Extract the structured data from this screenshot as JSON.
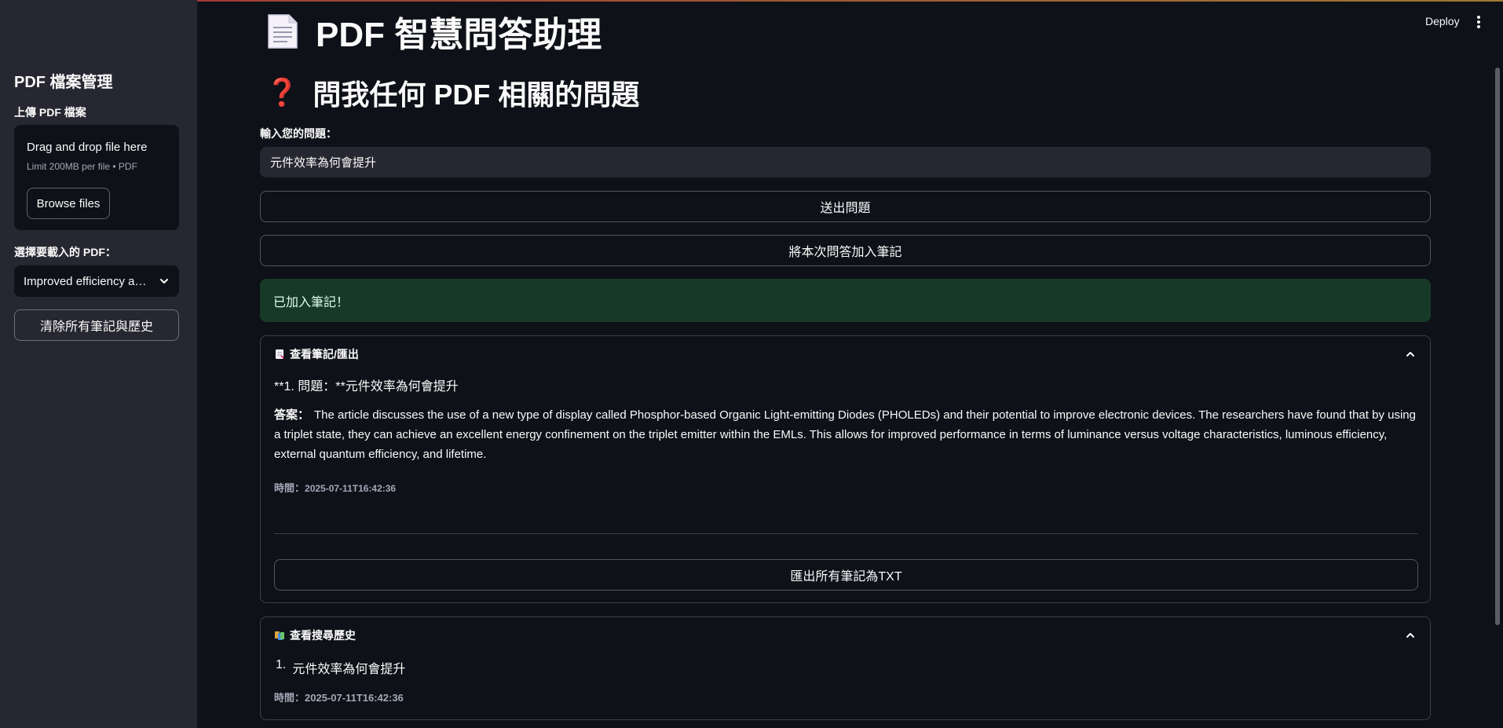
{
  "sidebar": {
    "title": "PDF 檔案管理",
    "upload_label": "上傳 PDF 檔案",
    "dropzone_title": "Drag and drop file here",
    "dropzone_limit": "Limit 200MB per file • PDF",
    "browse_label": "Browse files",
    "select_label": "選擇要載入的 PDF：",
    "select_value": "Improved efficiency and lifetime of PHOLEDs.pdf",
    "clear_label": "清除所有筆記與歷史"
  },
  "header": {
    "deploy_label": "Deploy"
  },
  "main": {
    "title": "PDF 智慧問答助理",
    "subtitle": "問我任何 PDF 相關的問題",
    "subtitle_icon": "❓",
    "input_label": "輸入您的問題：",
    "input_value": "元件效率為何會提升",
    "submit_label": "送出問題",
    "add_note_label": "將本次問答加入筆記",
    "success_message": "已加入筆記！"
  },
  "notes": {
    "header": "查看筆記/匯出",
    "question": "**1. 問題：**元件效率為何會提升",
    "answer_label": "答案：",
    "answer_text": "The article discusses the use of a new type of display called Phosphor-based Organic Light-emitting Diodes (PHOLEDs) and their potential to improve electronic devices. The researchers have found that by using a triplet state, they can achieve an excellent energy confinement on the triplet emitter within the EMLs. This allows for improved performance in terms of luminance versus voltage characteristics, luminous efficiency, external quantum efficiency, and lifetime.",
    "time_label": "時間：",
    "time_value": "2025-07-11T16:42:36",
    "export_label": "匯出所有筆記為TXT"
  },
  "history": {
    "header": "查看搜尋歷史",
    "items": [
      {
        "num": "1.",
        "text": "元件效率為何會提升"
      }
    ],
    "time_label": "時間：",
    "time_value": "2025-07-11T16:42:36"
  },
  "colors": {
    "background": "#0e1117",
    "sidebar": "#262730",
    "success_bg": "#173928",
    "success_text": "#dffde9",
    "accent": "#ff4b4b"
  }
}
